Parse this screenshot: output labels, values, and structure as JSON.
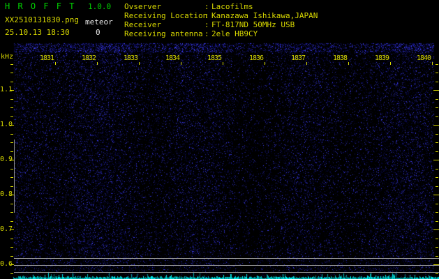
{
  "header": {
    "app_title": "H R O F F T",
    "version": "1.0.0",
    "filename": "XX2510131830.png",
    "mode": "meteor",
    "datetime": "25.10.13 18:30",
    "meteor_count": "0",
    "separator": ":",
    "info_rows": [
      {
        "label": "Ovserver",
        "value": "Lacofilms"
      },
      {
        "label": "Receiving Location",
        "value": "Kanazawa Ishikawa,JAPAN"
      },
      {
        "label": "Receiver",
        "value": "FT-817ND 50MHz USB"
      },
      {
        "label": "Receiving antenna",
        "value": "2ele HB9CY"
      }
    ]
  },
  "axes": {
    "freq_unit": "kHz",
    "freq_tick_labels": [
      "1.1",
      "1.0",
      "0.9",
      "0.8",
      "0.7",
      "0.6"
    ],
    "time_tick_labels": [
      "1831",
      "1832",
      "1833",
      "1834",
      "1835",
      "1836",
      "1837",
      "1838",
      "1839",
      "1840"
    ]
  },
  "colors": {
    "text_yellow": "#d8d800",
    "text_green": "#00d400",
    "text_white": "#e8e8e8",
    "grid_gray": "#9c9c9c",
    "signal_cyan": "#00dcdc",
    "background": "#000000"
  },
  "chart_data": {
    "type": "heatmap",
    "subtype": "HROFFT meteor-radio spectrogram",
    "title": "H R O F F T 1.0.0 — XX2510131830.png — 25.10.13 18:30",
    "x_tick_labels": [
      "1831",
      "1832",
      "1833",
      "1834",
      "1835",
      "1836",
      "1837",
      "1838",
      "1839",
      "1840"
    ],
    "x_minutes_shown": 10,
    "y_axis_unit": "kHz",
    "y_tick_labels": [
      "1.1",
      "1.0",
      "0.9",
      "0.8",
      "0.7",
      "0.6"
    ],
    "y_range_khz": [
      0.58,
      1.24
    ],
    "y_minor_tick_step_khz": 0.025,
    "meteor_echo_count": 0,
    "content_description": "uniform faint dark-blue background noise over black; slightly brighter noise band along the very top rows; no meteor echo traces visible",
    "horizontal_reference_lines_khz": [
      0.62,
      0.6,
      0.58
    ],
    "left_edge_marker_band_khz": [
      0.75,
      0.96
    ],
    "bottom_strip": "cyan signal-strength waveform spanning full width at bottom edge",
    "grid": "off",
    "legend": "none"
  }
}
